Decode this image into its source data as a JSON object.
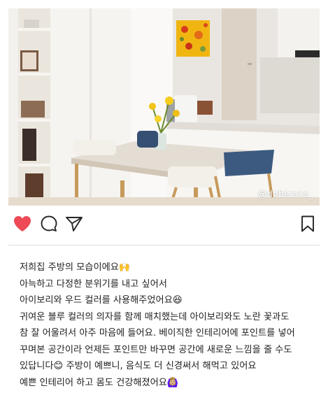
{
  "post": {
    "photo_watermark": "@dobicoco_",
    "photo_alt": "kitchen with ivory table, blue chairs and yellow flower painting"
  },
  "actions": {
    "like_icon": "heart-filled-icon",
    "comment_icon": "comment-bubble-icon",
    "share_icon": "paper-plane-icon",
    "save_icon": "bookmark-icon",
    "like_color": "#ed4956"
  },
  "caption": {
    "lines": [
      "저희집 주방의 모습이에요🙌",
      "아늑하고 다정한 분위기를 내고 싶어서",
      "아이보리와 우드 컬러를 사용해주었어요😆",
      "귀여운 블루 컬러의 의자를 함께 매치했는데 아이보리와도 노란 꽃과도",
      "참 잘 어울려서 아주 마음에 들어요. 베이직한 인테리어에 포인트를 넣어",
      "꾸며본 공간이라 언제든 포인트만 바꾸면 공간에 새로운 느낌을 줄 수도",
      " 있답니다😊 주방이 예쁘니, 음식도 더 신경써서 해먹고 있어요",
      "예쁜 인테리어 하고 몸도 건강해졌어요🙆🏼‍♀️"
    ]
  }
}
